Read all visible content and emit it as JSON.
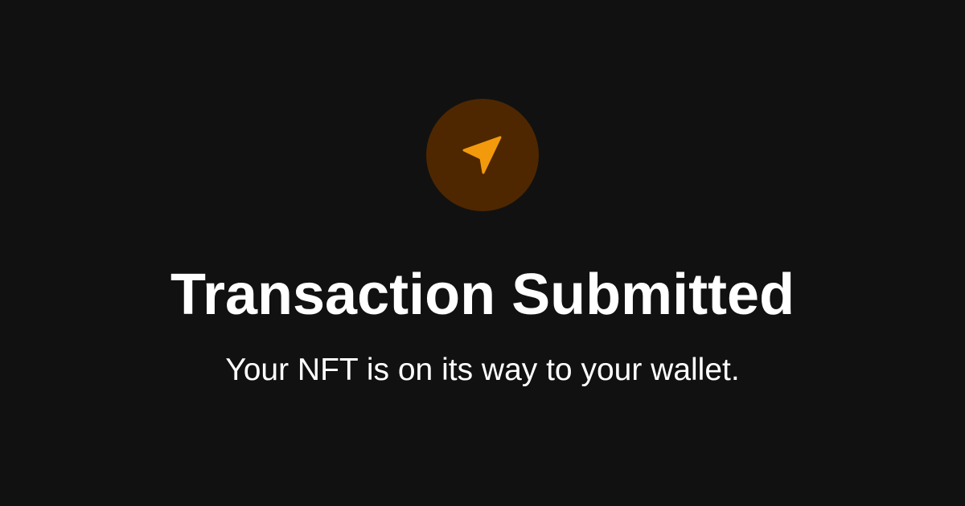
{
  "status": {
    "title": "Transaction Submitted",
    "message": "Your NFT is on its way to your wallet.",
    "icon": "send-arrow-icon"
  },
  "colors": {
    "background": "#111111",
    "icon_badge": "#4e2700",
    "icon_accent": "#f29a0b",
    "text": "#ffffff"
  }
}
